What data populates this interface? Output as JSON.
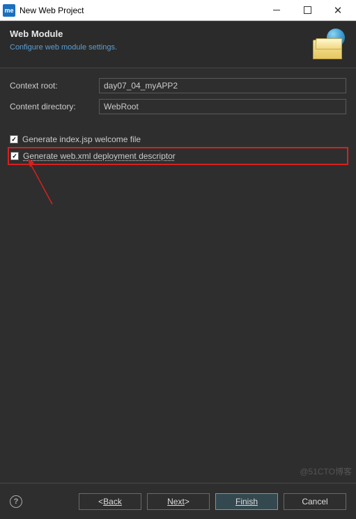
{
  "window": {
    "app_badge": "me",
    "title": "New Web Project"
  },
  "header": {
    "title": "Web Module",
    "subtitle": "Configure web module settings."
  },
  "form": {
    "context_root_label": "Context root:",
    "context_root_value": "day07_04_myAPP2",
    "content_dir_label": "Content directory:",
    "content_dir_value": "WebRoot"
  },
  "checkboxes": {
    "welcome": {
      "checked": true,
      "label": "Generate index.jsp welcome file"
    },
    "webxml": {
      "checked": true,
      "label": "Generate web.xml deployment descriptor"
    }
  },
  "buttons": {
    "back_prefix": "< ",
    "back": "Back",
    "next": "Next",
    "next_suffix": " >",
    "finish": "Finish",
    "cancel": "Cancel"
  },
  "watermark": "@51CTO博客"
}
